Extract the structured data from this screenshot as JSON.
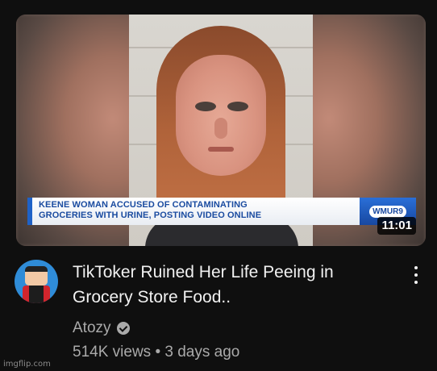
{
  "video": {
    "thumbnail": {
      "lower_third_line1": "KEENE WOMAN ACCUSED OF CONTAMINATING",
      "lower_third_line2": "GROCERIES WITH URINE, POSTING VIDEO ONLINE",
      "station_logo": "WMUR9",
      "duration": "11:01"
    },
    "title_line1": "TikToker Ruined Her Life Peeing in",
    "title_line2": "Grocery Store Food..",
    "channel_name": "Atozy",
    "views": "514K views",
    "separator": "•",
    "age": "3 days ago",
    "avatar_icon": "channel-avatar-icon",
    "verified_icon": "verified-check-icon",
    "menu_icon": "kebab-menu-icon"
  },
  "watermark": "imgflip.com",
  "colors": {
    "background": "#0f0f0f",
    "title_text": "#f1f1f1",
    "secondary_text": "#aaaaaa",
    "lower_third_text": "#1a4ba0",
    "lower_third_accent": "#1f62c7"
  }
}
